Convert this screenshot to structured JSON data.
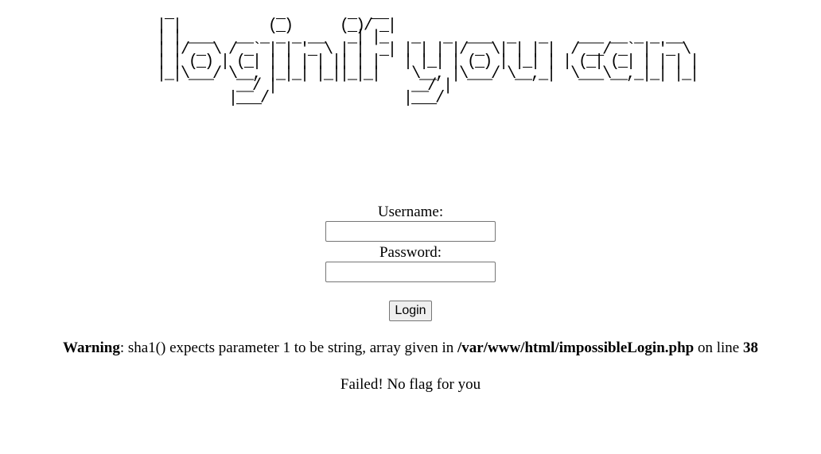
{
  "banner": {
    "ascii_art": " _             _        _  __\n| |           (_)      (_)/ _|\n| | ___   __ _ _ _ __   _| |_   _   _  ___  _   _    ___ __ _ _ __\n| |/ _ \\ / _` | | '_ \\ | |  _| | | | |/ _ \\| | | |  / __/ _` | '_ \\\n| | (_) | (_| | | | | || | |   | |_| | (_) | |_| | | (_| (_| | | | |\n|_|\\___/ \\__, |_|_| |_||_|_|    \\__, |\\___/ \\__,_|  \\___\\__,_|_| |_|\n          __/ |                 __/ |\n         |___/                 |___/"
  },
  "form": {
    "username_label": "Username:",
    "username_value": "",
    "password_label": "Password:",
    "password_value": "",
    "login_button": "Login"
  },
  "warning": {
    "prefix": "Warning",
    "message": ": sha1() expects parameter 1 to be string, array given in ",
    "path": "/var/www/html/impossibleLogin.php",
    "line_text": " on line ",
    "line_number": "38"
  },
  "result": {
    "text": "Failed! No flag for you"
  }
}
